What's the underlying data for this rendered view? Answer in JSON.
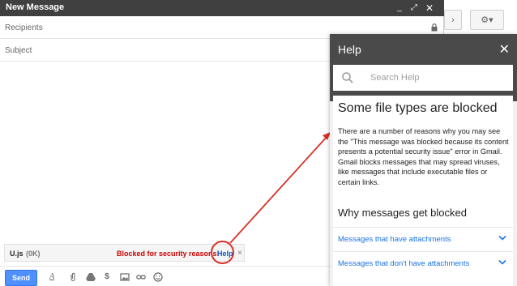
{
  "compose": {
    "title": "New Message",
    "recipients_placeholder": "Recipients",
    "subject_placeholder": "Subject",
    "header_buttons": {
      "minimize": "_",
      "popout": "⤢",
      "close": "✕"
    }
  },
  "attachment": {
    "name": "U.js",
    "size": "(0K)",
    "blocked_text": "Blocked for security reasons!",
    "help_link": "Help",
    "remove": "×"
  },
  "toolbar": {
    "send_label": "Send",
    "icons": [
      "format-text-icon",
      "attach-icon",
      "drive-icon",
      "money-icon",
      "photo-icon",
      "link-icon",
      "emoji-icon"
    ]
  },
  "background": {
    "next_glyph": "›",
    "gear_glyph": "⚙▾"
  },
  "help_panel": {
    "title": "Help",
    "close": "✕",
    "search_placeholder": "Search Help",
    "article_title": "Some file types are blocked",
    "article_body": "There are a number of reasons why you may see the \"This message was blocked because its content presents a potential security issue\" error in Gmail. Gmail blocks messages that may spread viruses, like messages that include executable files or certain links.",
    "section_title": "Why messages get blocked",
    "accordion": [
      {
        "label": "Messages that have attachments"
      },
      {
        "label": "Messages that don't have attachments"
      }
    ]
  },
  "colors": {
    "header_dark": "#404040",
    "help_header": "#4a4a4a",
    "blocked_red": "#cc0000",
    "link_blue": "#1155cc",
    "accordion_blue": "#1a73e8",
    "send_blue": "#4d90fe",
    "annotation_red": "#d93025"
  }
}
